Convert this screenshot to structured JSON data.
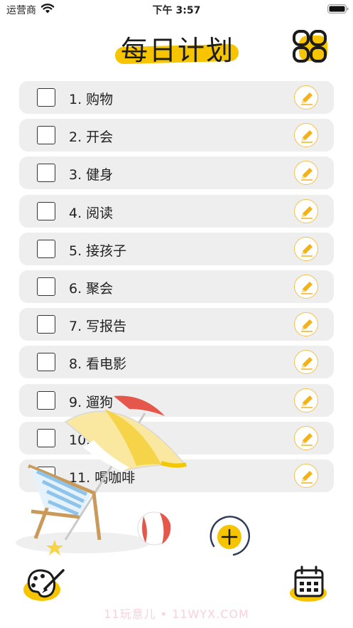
{
  "status_bar": {
    "carrier": "运营商",
    "time": "下午 3:57"
  },
  "header": {
    "title": "每日计划",
    "menu_icon": "grid-menu-icon"
  },
  "tasks": [
    {
      "label": "1. 购物",
      "checked": false
    },
    {
      "label": "2. 开会",
      "checked": false
    },
    {
      "label": "3. 健身",
      "checked": false
    },
    {
      "label": "4. 阅读",
      "checked": false
    },
    {
      "label": "5. 接孩子",
      "checked": false
    },
    {
      "label": "6. 聚会",
      "checked": false
    },
    {
      "label": "7. 写报告",
      "checked": false
    },
    {
      "label": "8. 看电影",
      "checked": false
    },
    {
      "label": "9. 遛狗",
      "checked": false
    },
    {
      "label": "10.烹饪课",
      "checked": false
    },
    {
      "label": "11. 喝咖啡",
      "checked": false
    }
  ],
  "icons": {
    "edit": "pencil-icon",
    "add": "plus-icon",
    "palette": "palette-icon",
    "calendar": "calendar-icon"
  },
  "colors": {
    "accent": "#f6c400",
    "row_bg": "#eeeeee",
    "edit_border": "#f3c34a",
    "text": "#222222"
  },
  "watermark": "11玩意儿 • 11WYX.COM"
}
